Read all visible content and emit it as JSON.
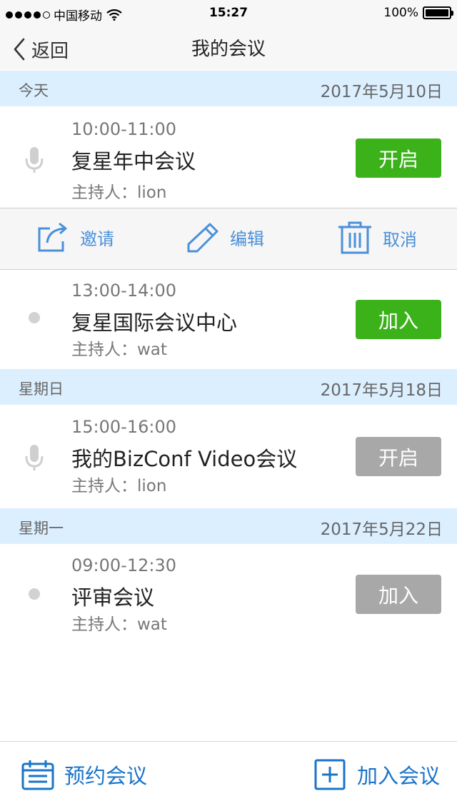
{
  "status_bar": {
    "carrier": "中国移动",
    "time": "15:27",
    "battery": "100%"
  },
  "nav": {
    "back_label": "返回",
    "title": "我的会议"
  },
  "sections": [
    {
      "day": "今天",
      "date": "2017年5月10日",
      "meetings": [
        {
          "time": "10:00-11:00",
          "name": "复星年中会议",
          "host": "主持人：lion",
          "button": "开启",
          "icon": "microphone-icon",
          "button_color": "#3bb11a"
        },
        {
          "time": "13:00-14:00",
          "name": "复星国际会议中心",
          "host": "主持人：wat",
          "button": "加入",
          "icon": "bullet-dot",
          "button_color": "#3bb11a"
        }
      ]
    },
    {
      "day": "星期日",
      "date": "2017年5月18日",
      "meetings": [
        {
          "time": "15:00-16:00",
          "name": "我的BizConf Video会议",
          "host": "主持人：lion",
          "button": "开启",
          "icon": "microphone-icon",
          "button_color": "#a8a8a8"
        }
      ]
    },
    {
      "day": "星期一",
      "date": "2017年5月22日",
      "meetings": [
        {
          "time": "09:00-12:30",
          "name": "评审会议",
          "host": "主持人：wat",
          "button": "加入",
          "icon": "bullet-dot",
          "button_color": "#a8a8a8"
        }
      ]
    }
  ],
  "actions": {
    "invite": "邀请",
    "edit": "编辑",
    "cancel": "取消"
  },
  "bottom": {
    "schedule": "预约会议",
    "join": "加入会议"
  },
  "colors": {
    "accent_blue": "#1a74c9",
    "action_blue": "#4a90d9",
    "green": "#3bb11a",
    "gray_button": "#a8a8a8",
    "section_bg": "#dcefff"
  }
}
